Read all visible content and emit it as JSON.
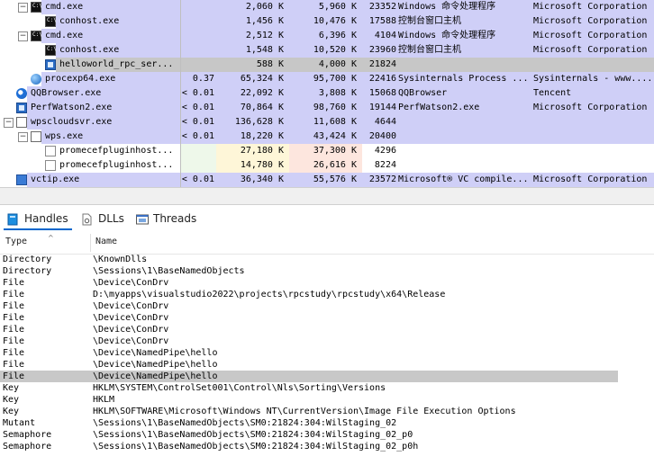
{
  "processes": [
    {
      "name": "cmd.exe",
      "depth": 1,
      "toggle": "minus",
      "icon": "cmd-icon",
      "cpu": "",
      "private_bytes": "2,060 K",
      "working_set": "5,960 K",
      "pid": "23352",
      "description": "Windows 命令处理程序",
      "company": "Microsoft Corporation",
      "highlight": "lavender"
    },
    {
      "name": "conhost.exe",
      "depth": 2,
      "toggle": "",
      "icon": "console-icon",
      "cpu": "",
      "private_bytes": "1,456 K",
      "working_set": "10,476 K",
      "pid": "17588",
      "description": "控制台窗口主机",
      "company": "Microsoft Corporation",
      "highlight": "lavender"
    },
    {
      "name": "cmd.exe",
      "depth": 1,
      "toggle": "minus",
      "icon": "cmd-icon",
      "cpu": "",
      "private_bytes": "2,512 K",
      "working_set": "6,396 K",
      "pid": "4104",
      "description": "Windows 命令处理程序",
      "company": "Microsoft Corporation",
      "highlight": "lavender"
    },
    {
      "name": "conhost.exe",
      "depth": 2,
      "toggle": "",
      "icon": "console-icon",
      "cpu": "",
      "private_bytes": "1,548 K",
      "working_set": "10,520 K",
      "pid": "23960",
      "description": "控制台窗口主机",
      "company": "Microsoft Corporation",
      "highlight": "lavender"
    },
    {
      "name": "helloworld_rpc_ser...",
      "depth": 2,
      "toggle": "",
      "icon": "window-icon",
      "cpu": "",
      "private_bytes": "588 K",
      "working_set": "4,000 K",
      "pid": "21824",
      "description": "",
      "company": "",
      "highlight": "selected"
    },
    {
      "name": "procexp64.exe",
      "depth": 1,
      "toggle": "",
      "icon": "globe-icon",
      "cpu": "0.37",
      "private_bytes": "65,324 K",
      "working_set": "95,700 K",
      "pid": "22416",
      "description": "Sysinternals Process ...",
      "company": "Sysinternals - www....",
      "highlight": "lavender"
    },
    {
      "name": "QQBrowser.exe",
      "depth": 0,
      "toggle": "",
      "icon": "qqbrowser-icon",
      "cpu": "< 0.01",
      "private_bytes": "22,092 K",
      "working_set": "3,808 K",
      "pid": "15068",
      "description": "QQBrowser",
      "company": "Tencent",
      "highlight": "lavender"
    },
    {
      "name": "PerfWatson2.exe",
      "depth": 0,
      "toggle": "",
      "icon": "window-icon",
      "cpu": "< 0.01",
      "private_bytes": "70,864 K",
      "working_set": "98,760 K",
      "pid": "19144",
      "description": "PerfWatson2.exe",
      "company": "Microsoft Corporation",
      "highlight": "lavender"
    },
    {
      "name": "wpscloudsvr.exe",
      "depth": 0,
      "toggle": "minus",
      "icon": "wps-icon",
      "cpu": "< 0.01",
      "private_bytes": "136,628 K",
      "working_set": "11,608 K",
      "pid": "4644",
      "description": "",
      "company": "",
      "highlight": "lavender"
    },
    {
      "name": "wps.exe",
      "depth": 1,
      "toggle": "minus",
      "icon": "wps-icon",
      "cpu": "< 0.01",
      "private_bytes": "18,220 K",
      "working_set": "43,424 K",
      "pid": "20400",
      "description": "",
      "company": "",
      "highlight": "lavender"
    },
    {
      "name": "promecefpluginhost...",
      "depth": 2,
      "toggle": "",
      "icon": "document-icon",
      "cpu": "",
      "private_bytes": "27,180 K",
      "working_set": "37,300 K",
      "pid": "4296",
      "description": "",
      "company": "",
      "highlight": "none"
    },
    {
      "name": "promecefpluginhost...",
      "depth": 2,
      "toggle": "",
      "icon": "document-icon",
      "cpu": "",
      "private_bytes": "14,780 K",
      "working_set": "26,616 K",
      "pid": "8224",
      "description": "",
      "company": "",
      "highlight": "none"
    },
    {
      "name": "vctip.exe",
      "depth": 0,
      "toggle": "",
      "icon": "blue-app-icon",
      "cpu": "< 0.01",
      "private_bytes": "36,340 K",
      "working_set": "55,576 K",
      "pid": "23572",
      "description": "Microsoft® VC compile...",
      "company": "Microsoft Corporation",
      "highlight": "lavender"
    }
  ],
  "tabs": [
    {
      "label": "Handles",
      "icon": "handles-icon",
      "active": true
    },
    {
      "label": "DLLs",
      "icon": "dlls-icon",
      "active": false
    },
    {
      "label": "Threads",
      "icon": "threads-icon",
      "active": false
    }
  ],
  "handles": {
    "columns": {
      "type": "Type",
      "name": "Name"
    },
    "rows": [
      {
        "type": "Directory",
        "name": "\\KnownDlls",
        "selected": false
      },
      {
        "type": "Directory",
        "name": "\\Sessions\\1\\BaseNamedObjects",
        "selected": false
      },
      {
        "type": "File",
        "name": "\\Device\\ConDrv",
        "selected": false
      },
      {
        "type": "File",
        "name": "D:\\myapps\\visualstudio2022\\projects\\rpcstudy\\rpcstudy\\x64\\Release",
        "selected": false
      },
      {
        "type": "File",
        "name": "\\Device\\ConDrv",
        "selected": false
      },
      {
        "type": "File",
        "name": "\\Device\\ConDrv",
        "selected": false
      },
      {
        "type": "File",
        "name": "\\Device\\ConDrv",
        "selected": false
      },
      {
        "type": "File",
        "name": "\\Device\\ConDrv",
        "selected": false
      },
      {
        "type": "File",
        "name": "\\Device\\NamedPipe\\hello",
        "selected": false
      },
      {
        "type": "File",
        "name": "\\Device\\NamedPipe\\hello",
        "selected": false
      },
      {
        "type": "File",
        "name": "\\Device\\NamedPipe\\hello",
        "selected": true
      },
      {
        "type": "Key",
        "name": "HKLM\\SYSTEM\\ControlSet001\\Control\\Nls\\Sorting\\Versions",
        "selected": false
      },
      {
        "type": "Key",
        "name": "HKLM",
        "selected": false
      },
      {
        "type": "Key",
        "name": "HKLM\\SOFTWARE\\Microsoft\\Windows NT\\CurrentVersion\\Image File Execution Options",
        "selected": false
      },
      {
        "type": "Mutant",
        "name": "\\Sessions\\1\\BaseNamedObjects\\SM0:21824:304:WilStaging_02",
        "selected": false
      },
      {
        "type": "Semaphore",
        "name": "\\Sessions\\1\\BaseNamedObjects\\SM0:21824:304:WilStaging_02_p0",
        "selected": false
      },
      {
        "type": "Semaphore",
        "name": "\\Sessions\\1\\BaseNamedObjects\\SM0:21824:304:WilStaging_02_p0h",
        "selected": false
      }
    ]
  },
  "colors": {
    "lavender": "#cfcff7",
    "selected": "#c7c7c7",
    "cpu_col": "#eef8ea",
    "private_col": "#fef6d8",
    "working_col": "#fde6de",
    "handle_selected": "#c8c8c8",
    "tab_accent": "#0066cc"
  }
}
